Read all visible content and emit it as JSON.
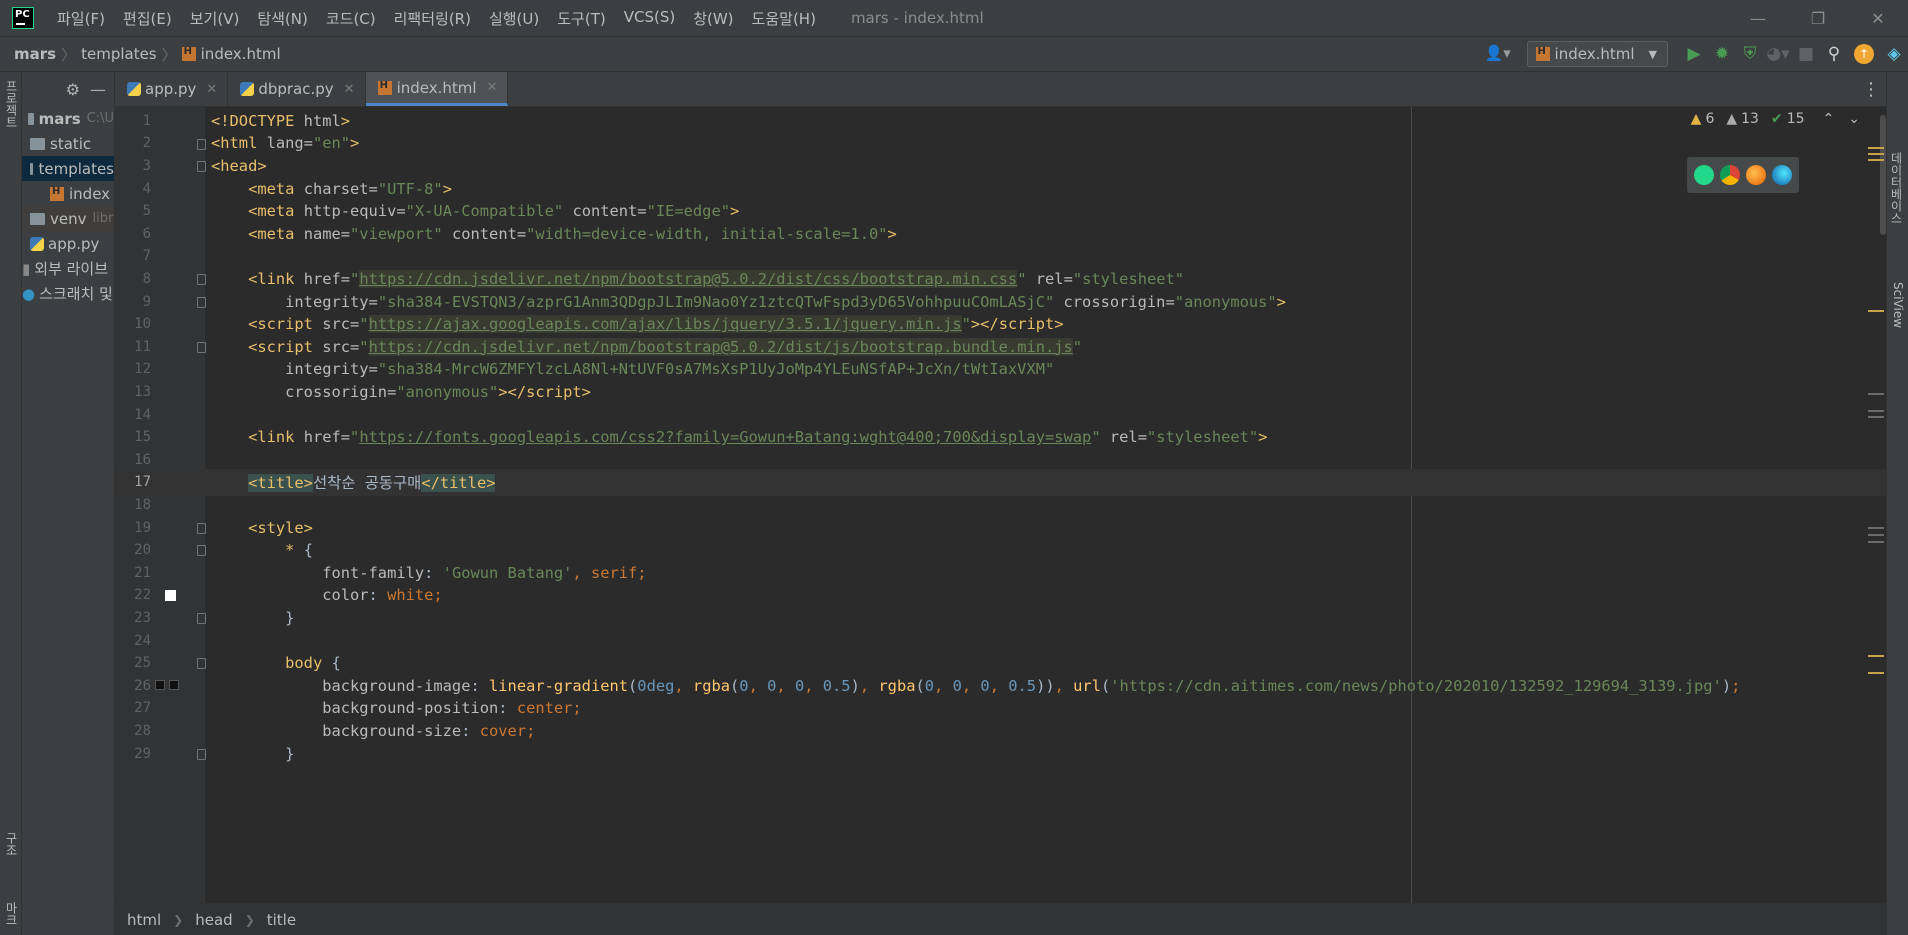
{
  "menu": [
    "파일(F)",
    "편집(E)",
    "보기(V)",
    "탐색(N)",
    "코드(C)",
    "리팩터링(R)",
    "실행(U)",
    "도구(T)",
    "VCS(S)",
    "창(W)",
    "도움말(H)"
  ],
  "window_title": "mars - index.html",
  "breadcrumb": {
    "root": "mars",
    "folder": "templates",
    "file": "index.html"
  },
  "run_config": "index.html",
  "left_strip": {
    "project": "프로젝트",
    "structure": "구조",
    "bookmarks": "마크"
  },
  "right_strip": {
    "database": "데이터베이스",
    "sciview": "SciView"
  },
  "project_tree": [
    {
      "label": "mars",
      "hint": "C:\\U",
      "type": "folder"
    },
    {
      "label": "static",
      "type": "folder"
    },
    {
      "label": "templates",
      "type": "folder"
    },
    {
      "label": "index",
      "type": "html"
    },
    {
      "label": "venv",
      "hint": "libr",
      "type": "folder"
    },
    {
      "label": "app.py",
      "type": "py"
    },
    {
      "label": "외부 라이브",
      "type": "lib"
    },
    {
      "label": "스크래치 및",
      "type": "scratch"
    }
  ],
  "tabs": [
    {
      "label": "app.py",
      "type": "py"
    },
    {
      "label": "dbprac.py",
      "type": "py"
    },
    {
      "label": "index.html",
      "type": "html",
      "active": true
    }
  ],
  "inspections": {
    "warnings_a": "6",
    "warnings_b": "13",
    "ok": "15"
  },
  "line_numbers": [
    "1",
    "2",
    "3",
    "4",
    "5",
    "6",
    "7",
    "8",
    "9",
    "10",
    "11",
    "12",
    "13",
    "14",
    "15",
    "16",
    "17",
    "18",
    "19",
    "20",
    "21",
    "22",
    "23",
    "24",
    "25",
    "26",
    "27",
    "28",
    "29"
  ],
  "current_line": "17",
  "footer_path": [
    "html",
    "head",
    "title"
  ],
  "colors": {
    "accent": "#4a88c7",
    "editor_bg": "#2b2b2b",
    "panel_bg": "#3c3f41",
    "tag": "#e8bf6a",
    "string": "#6a8759"
  }
}
